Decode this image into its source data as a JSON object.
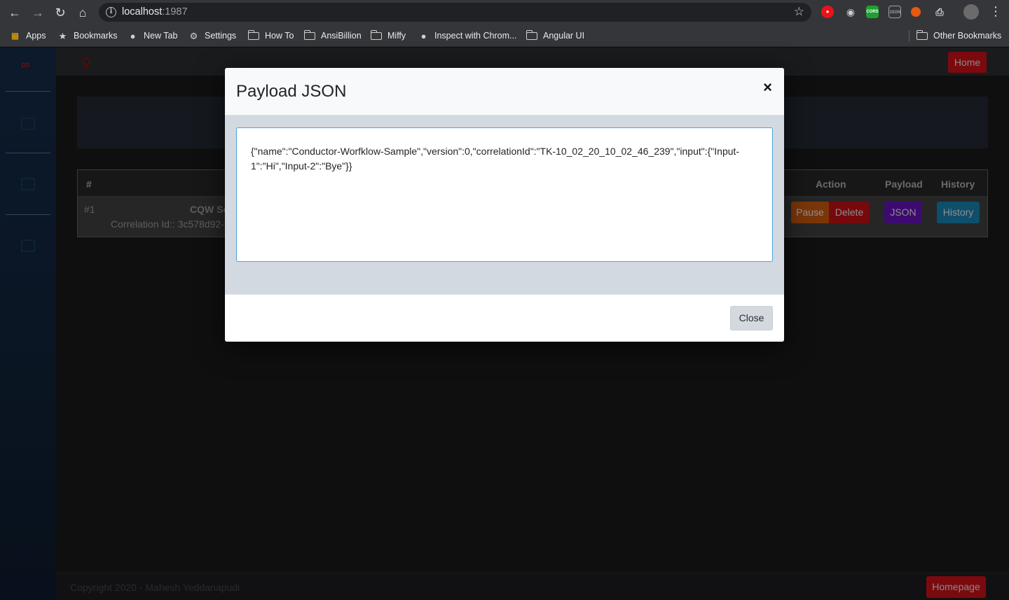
{
  "browser": {
    "url_host": "localhost",
    "url_port": ":1987",
    "bookmarks": [
      {
        "label": "Apps",
        "icon": "apps-grid-icon"
      },
      {
        "label": "Bookmarks",
        "icon": "star-icon"
      },
      {
        "label": "New Tab",
        "icon": "globe-icon"
      },
      {
        "label": "Settings",
        "icon": "gear-icon"
      },
      {
        "label": "How To",
        "icon": "folder-icon"
      },
      {
        "label": "AnsiBillion",
        "icon": "folder-icon"
      },
      {
        "label": "Miffy",
        "icon": "folder-icon"
      },
      {
        "label": "Inspect with Chrom...",
        "icon": "globe-icon"
      },
      {
        "label": "Angular UI",
        "icon": "folder-icon"
      }
    ],
    "other_bookmarks": "Other Bookmarks",
    "extensions": {
      "ext_colors": [
        "#e8131b",
        "#cccccc",
        "#1fa02e",
        "#9aa0a6",
        "#e8590c",
        "#cfcfcf"
      ],
      "cors_label": "CORS",
      "json_label": "JSON"
    }
  },
  "app": {
    "home_label": "Home",
    "table": {
      "headers": {
        "num": "#",
        "action": "Action",
        "payload": "Payload",
        "history": "History"
      },
      "rows": [
        {
          "num": "#1",
          "name_fragment": "CQW Sc",
          "correlation_fragment": "Correlation Id:: 3c578d92-",
          "pause": "Pause",
          "delete": "Delete",
          "json": "JSON",
          "history": "History"
        }
      ]
    },
    "footer_copyright": "Copyright 2020 - Mahesh Yeddanapudi",
    "homepage_label": "Homepage",
    "colors": {
      "pause": "#7a3609",
      "delete": "#76090c",
      "json": "#3d0a70",
      "history": "#0e4f6b"
    }
  },
  "modal": {
    "title": "Payload JSON",
    "close_x": "×",
    "json_text": "{\"name\":\"Conductor-Worfklow-Sample\",\"version\":0,\"correlationId\":\"TK-10_02_20_10_02_46_239\",\"input\":{\"Input-1\":\"Hi\",\"Input-2\":\"Bye\"}}",
    "close_label": "Close"
  }
}
